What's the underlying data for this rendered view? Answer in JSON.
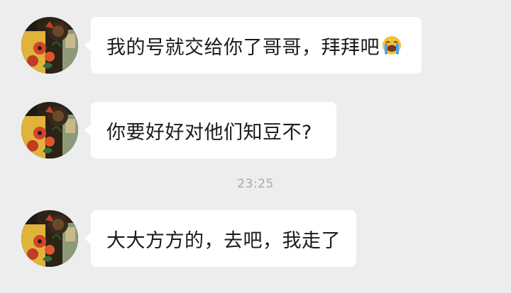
{
  "messages": [
    {
      "text": "我的号就交给你了哥哥，拜拜吧",
      "emoji": "loudly-crying-face"
    },
    {
      "text": "你要好好对他们知豆不?"
    },
    {
      "text": "大大方方的，去吧，我走了"
    }
  ],
  "timestamp": "23:25",
  "colors": {
    "background": "#ededed",
    "bubble": "#ffffff",
    "text": "#1a1a1a",
    "timestamp": "#a9a9a9"
  }
}
